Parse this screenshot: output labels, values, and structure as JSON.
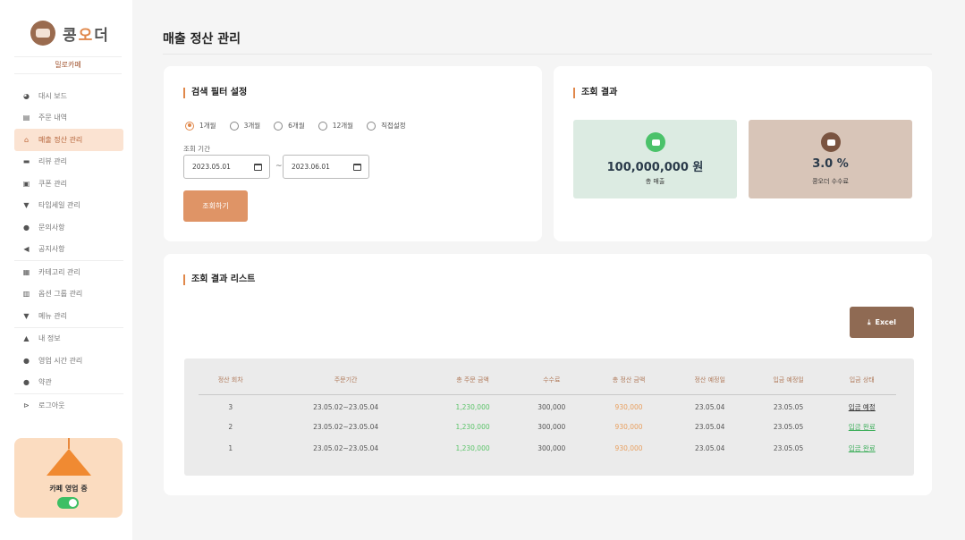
{
  "brand": {
    "name_pre": "콩",
    "name_accent": "오",
    "name_post": "더",
    "store": "밀로카페"
  },
  "sidebar": {
    "groups": [
      [
        {
          "label": "대시 보드",
          "icon": "pie-chart-icon",
          "glyph": "◕"
        },
        {
          "label": "주문 내역",
          "icon": "receipt-icon",
          "glyph": "▤"
        },
        {
          "label": "매출 정산 관리",
          "icon": "store-icon",
          "glyph": "⌂",
          "active": true
        },
        {
          "label": "리뷰 관리",
          "icon": "chat-icon",
          "glyph": "▬"
        },
        {
          "label": "쿠폰 관리",
          "icon": "coupon-icon",
          "glyph": "▣"
        },
        {
          "label": "타임세일 관리",
          "icon": "cart-icon",
          "glyph": "▼"
        },
        {
          "label": "문의사항",
          "icon": "help-icon",
          "glyph": "●"
        },
        {
          "label": "공지사항",
          "icon": "megaphone-icon",
          "glyph": "◀"
        }
      ],
      [
        {
          "label": "카테고리 관리",
          "icon": "grid-icon",
          "glyph": "▦"
        },
        {
          "label": "옵션 그룹 관리",
          "icon": "list-icon",
          "glyph": "▥"
        },
        {
          "label": "메뉴 관리",
          "icon": "cup-icon",
          "glyph": "▼"
        }
      ],
      [
        {
          "label": "내 정보",
          "icon": "user-icon",
          "glyph": "▲"
        },
        {
          "label": "영업 시간 관리",
          "icon": "clock-icon",
          "glyph": "●"
        },
        {
          "label": "약관",
          "icon": "info-icon",
          "glyph": "●"
        }
      ],
      [
        {
          "label": "로그아웃",
          "icon": "logout-icon",
          "glyph": "⊳"
        }
      ]
    ],
    "status_label": "카페 영업 중"
  },
  "page": {
    "title": "매출 정산 관리"
  },
  "filter": {
    "title": "검색 필터 설정",
    "options": [
      "1개월",
      "3개월",
      "6개월",
      "12개월",
      "직접설정"
    ],
    "selected": 0,
    "period_label": "조회 기간",
    "start_date": "2023.05.01",
    "end_date": "2023.06.01",
    "tilde": "~",
    "search_label": "조회하기"
  },
  "result": {
    "title": "조회 결과",
    "total_sales": "100,000,000 원",
    "total_sales_label": "총 매출",
    "fee_rate": "3.0 %",
    "fee_rate_label": "콩오더 수수료",
    "colors": {
      "sales_bg": "#dcebe2",
      "sales_icon": "#4bc26a",
      "fee_bg": "#d8c5b8",
      "fee_icon": "#7a5440"
    }
  },
  "list": {
    "title": "조회 결과 리스트",
    "excel_label": "Excel",
    "columns": [
      "정산 회차",
      "주문기간",
      "총 주문 금액",
      "수수료",
      "총 정산 금액",
      "정산 예정일",
      "입금 예정일",
      "입금 상태"
    ],
    "rows": [
      {
        "round": "3",
        "period": "23.05.02~23.05.04",
        "order_total": "1,230,000",
        "fee": "300,000",
        "settle_total": "930,000",
        "settle_date": "23.05.04",
        "deposit_date": "23.05.05",
        "status": "입금 예정",
        "status_type": "pending"
      },
      {
        "round": "2",
        "period": "23.05.02~23.05.04",
        "order_total": "1,230,000",
        "fee": "300,000",
        "settle_total": "930,000",
        "settle_date": "23.05.04",
        "deposit_date": "23.05.05",
        "status": "입금 완료",
        "status_type": "done"
      },
      {
        "round": "1",
        "period": "23.05.02~23.05.04",
        "order_total": "1,230,000",
        "fee": "300,000",
        "settle_total": "930,000",
        "settle_date": "23.05.04",
        "deposit_date": "23.05.05",
        "status": "입금 완료",
        "status_type": "done"
      }
    ]
  }
}
